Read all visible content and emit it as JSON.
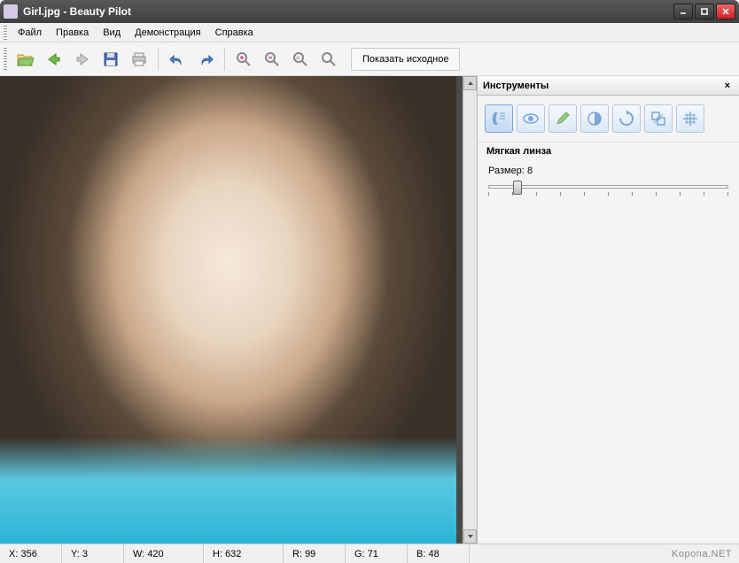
{
  "window": {
    "title": "Girl.jpg - Beauty Pilot"
  },
  "menu": {
    "file": "Файл",
    "edit": "Правка",
    "view": "Вид",
    "demo": "Демонстрация",
    "help": "Справка"
  },
  "toolbar": {
    "show_original": "Показать исходное"
  },
  "panel": {
    "title": "Инструменты",
    "section": "Мягкая линза",
    "size_label": "Размер:",
    "size_value": "8"
  },
  "tools": {
    "t1": "face-profile",
    "t2": "eye",
    "t3": "brush",
    "t4": "contrast",
    "t5": "rotate",
    "t6": "resize",
    "t7": "grid"
  },
  "status": {
    "x_label": "X:",
    "x": "356",
    "y_label": "Y:",
    "y": "3",
    "w_label": "W:",
    "w": "420",
    "h_label": "H:",
    "h": "632",
    "r_label": "R:",
    "r": "99",
    "g_label": "G:",
    "g": "71",
    "b_label": "B:",
    "b": "48"
  },
  "watermark": "Kopona.NET"
}
